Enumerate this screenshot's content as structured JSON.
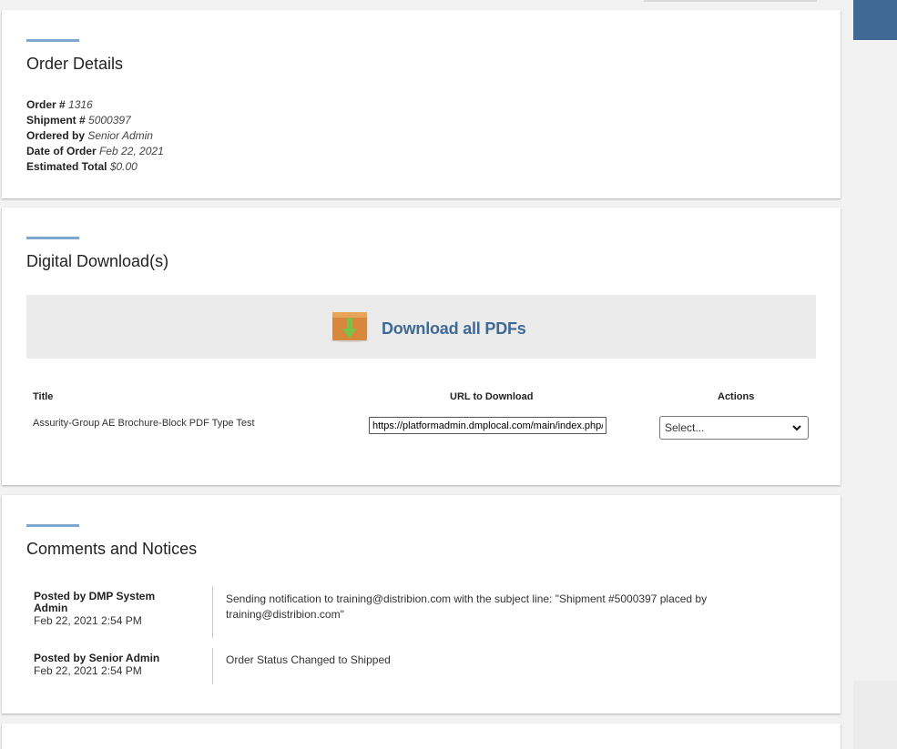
{
  "order_details": {
    "title": "Order Details",
    "rows": [
      {
        "label": "Order #",
        "value": "1316"
      },
      {
        "label": "Shipment #",
        "value": "5000397"
      },
      {
        "label": "Ordered by",
        "value": "Senior Admin"
      },
      {
        "label": "Date of Order",
        "value": "Feb 22, 2021"
      },
      {
        "label": "Estimated Total",
        "value": "$0.00"
      }
    ]
  },
  "downloads": {
    "title": "Digital Download(s)",
    "download_all_label": "Download all PDFs",
    "columns": {
      "title": "Title",
      "url": "URL to Download",
      "actions": "Actions"
    },
    "items": [
      {
        "title": "Assurity-Group AE Brochure-Block PDF Type Test",
        "url": "https://platformadmin.dmplocal.com/main/index.php/?",
        "action_selected": "Select..."
      }
    ]
  },
  "comments": {
    "title": "Comments and Notices",
    "items": [
      {
        "author": "Posted by DMP System Admin",
        "date": "Feb 22, 2021 2:54 PM",
        "text": "Sending notification to training@distribion.com with the subject line: \"Shipment #5000397 placed by training@distribion.com\""
      },
      {
        "author": "Posted by Senior Admin",
        "date": "Feb 22, 2021 2:54 PM",
        "text": "Order Status Changed to Shipped"
      }
    ]
  },
  "colors": {
    "accent": "#7ea6cf",
    "brand_blue": "#3f6a96",
    "box_orange": "#d9873d",
    "arrow_green": "#7cc04a"
  }
}
